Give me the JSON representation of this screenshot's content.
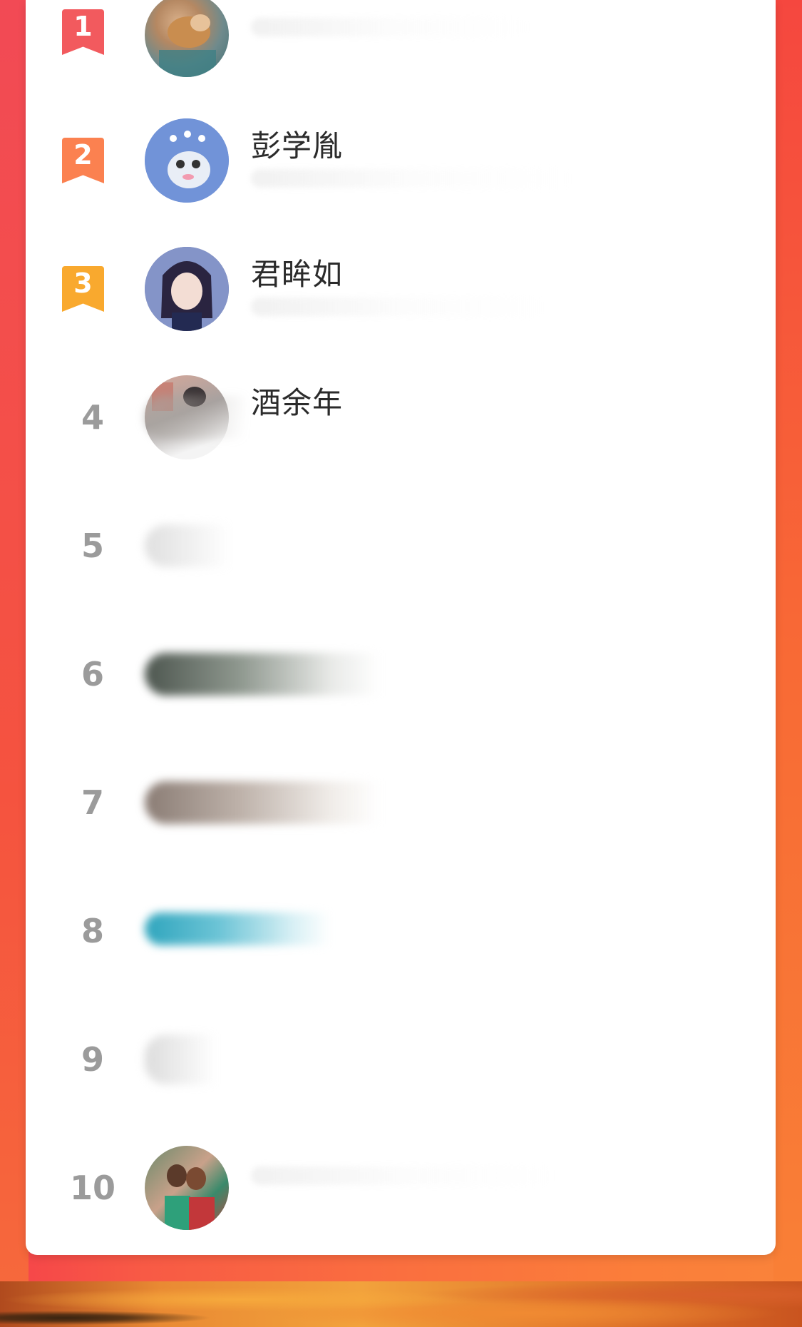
{
  "ranking": {
    "rows": [
      {
        "rank": "1",
        "name": ""
      },
      {
        "rank": "2",
        "name": "彭学胤"
      },
      {
        "rank": "3",
        "name": "君眸如"
      },
      {
        "rank": "4",
        "name": "酒余年"
      },
      {
        "rank": "5",
        "name": ""
      },
      {
        "rank": "6",
        "name": ""
      },
      {
        "rank": "7",
        "name": ""
      },
      {
        "rank": "8",
        "name": ""
      },
      {
        "rank": "9",
        "name": ""
      },
      {
        "rank": "10",
        "name": ""
      }
    ]
  },
  "colors": {
    "rank1": "#f25a5e",
    "rank2": "#fb8150",
    "rank3": "#f9a92e",
    "rank_plain": "#9b9b9b",
    "background_left": "#f5434a",
    "background_right": "#f9833a"
  }
}
